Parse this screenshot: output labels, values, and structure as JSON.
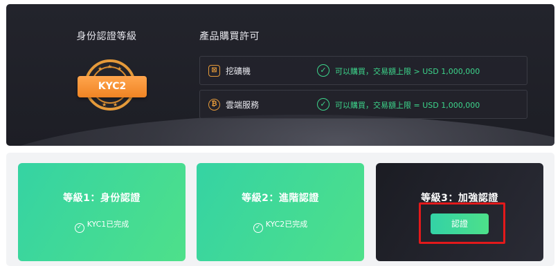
{
  "kyc": {
    "title": "身份認證等級",
    "badge_label": "KYC2"
  },
  "permissions": {
    "title": "產品購買許可",
    "items": [
      {
        "icon": "mining-machine-icon",
        "name": "挖礦機",
        "status": "可以購買，交易額上限 > USD 1,000,000"
      },
      {
        "icon": "bitcoin-icon",
        "name": "雲端服務",
        "status": "可以購買，交易額上限 = USD 1,000,000"
      }
    ]
  },
  "levels": [
    {
      "title": "等級1：身份認證",
      "status": "KYC1已完成"
    },
    {
      "title": "等級2：進階認證",
      "status": "KYC2已完成"
    },
    {
      "title": "等級3：加強認證",
      "button_label": "認證"
    }
  ],
  "colors": {
    "accent_orange": "#f08424",
    "success_green": "#3dd68c",
    "card_green": "#35d3a3",
    "highlight_red": "#e3191b"
  }
}
